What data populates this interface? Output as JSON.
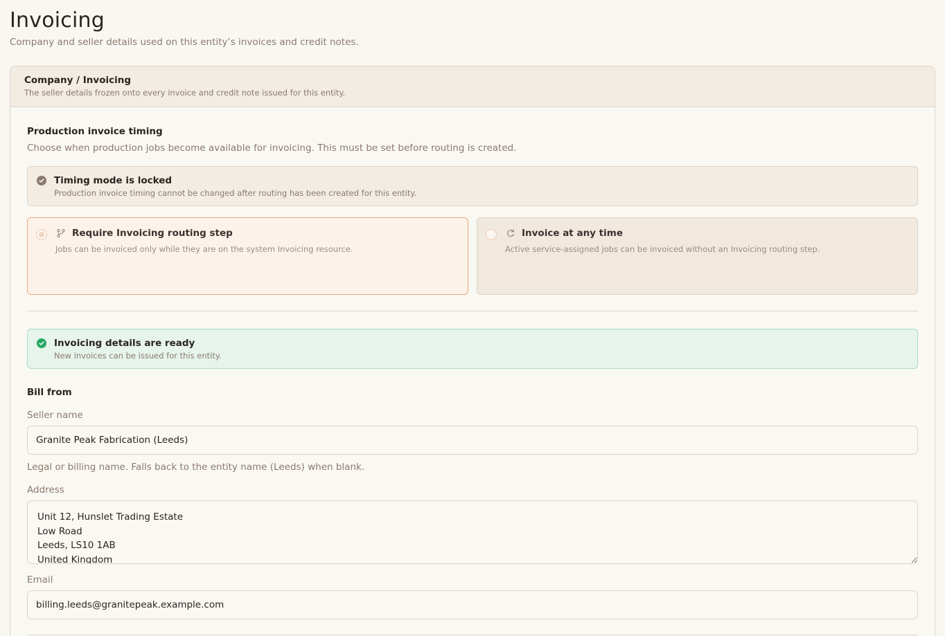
{
  "page": {
    "title": "Invoicing",
    "subtitle": "Company and seller details used on this entity’s invoices and credit notes."
  },
  "card": {
    "title": "Company / Invoicing",
    "subtitle": "The seller details frozen onto every invoice and credit note issued for this entity."
  },
  "timing": {
    "title": "Production invoice timing",
    "description": "Choose when production jobs become available for invoicing. This must be set before routing is created.",
    "locked_notice": {
      "title": "Timing mode is locked",
      "text": "Production invoice timing cannot be changed after routing has been created for this entity.",
      "icon": "check-circle-icon"
    },
    "options": [
      {
        "title": "Require Invoicing routing step",
        "text": "Jobs can be invoiced only while they are on the system Invoicing resource.",
        "icon": "branch-icon",
        "selected": true
      },
      {
        "title": "Invoice at any time",
        "text": "Active service-assigned jobs can be invoiced without an Invoicing routing step.",
        "icon": "refresh-icon",
        "selected": false
      }
    ]
  },
  "ready_notice": {
    "title": "Invoicing details are ready",
    "text": "New invoices can be issued for this entity.",
    "icon": "check-circle-icon"
  },
  "bill_from": {
    "title": "Bill from",
    "seller_name": {
      "label": "Seller name",
      "value": "Granite Peak Fabrication (Leeds)",
      "help": "Legal or billing name. Falls back to the entity name (Leeds) when blank."
    },
    "address": {
      "label": "Address",
      "value": "Unit 12, Hunslet Trading Estate\nLow Road\nLeeds, LS10 1AB\nUnited Kingdom"
    },
    "email": {
      "label": "Email",
      "value": "billing.leeds@granitepeak.example.com"
    }
  },
  "colors": {
    "background": "#f9f7f2",
    "selected_border": "#e9a87c",
    "ready_green": "#28a865",
    "muted_text": "#8a7a6e"
  }
}
